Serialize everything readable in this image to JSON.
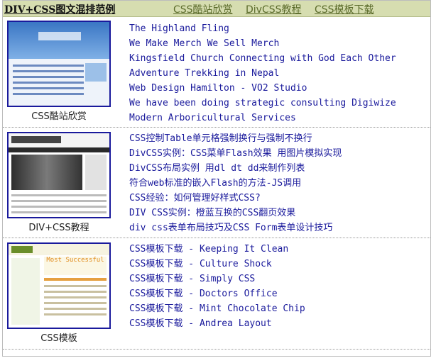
{
  "header": {
    "site_title": "DIV+CSS图文混排范例",
    "nav": [
      "CSS酷站欣赏",
      "DivCSS教程",
      "CSS模板下载"
    ]
  },
  "sections": [
    {
      "caption": "CSS酷站欣赏",
      "links": [
        "The Highland Fling",
        "We Make Merch We Sell Merch",
        "Kingsfield Church Connecting with God Each Other",
        "Adventure Trekking in Nepal",
        "Web Design Hamilton - VO2 Studio",
        "We have been doing strategic consulting Digiwize",
        "Modern Arboricultural Services"
      ]
    },
    {
      "caption": "DIV+CSS教程",
      "links": [
        "CSS控制Table单元格强制换行与强制不换行",
        "DivCSS实例：CSS菜单Flash效果 用图片模拟实现",
        "DivCSS布局实例 用dl dt dd来制作列表",
        "符合web标准的嵌入Flash的方法-JS调用",
        "CSS经验：如何管理好样式CSS?",
        "DIV CSS实例：橙蓝互换的CSS翻页效果",
        "div css表单布局技巧及CSS Form表单设计技巧"
      ]
    },
    {
      "caption": "CSS模板",
      "links": [
        "CSS模板下载 - Keeping It Clean",
        "CSS模板下载 - Culture Shock",
        "CSS模板下载 - Simply CSS",
        "CSS模板下载 - Doctors Office",
        "CSS模板下载 - Mint Chocolate Chip",
        "CSS模板下载 - Andrea Layout"
      ]
    }
  ],
  "thumb3_headline": "Most Successful",
  "colors": {
    "header_bg": "#d6ddb0",
    "link": "#1a1a9c",
    "nav_link": "#5a6a2a",
    "thumb_border": "#1a1a9c"
  }
}
